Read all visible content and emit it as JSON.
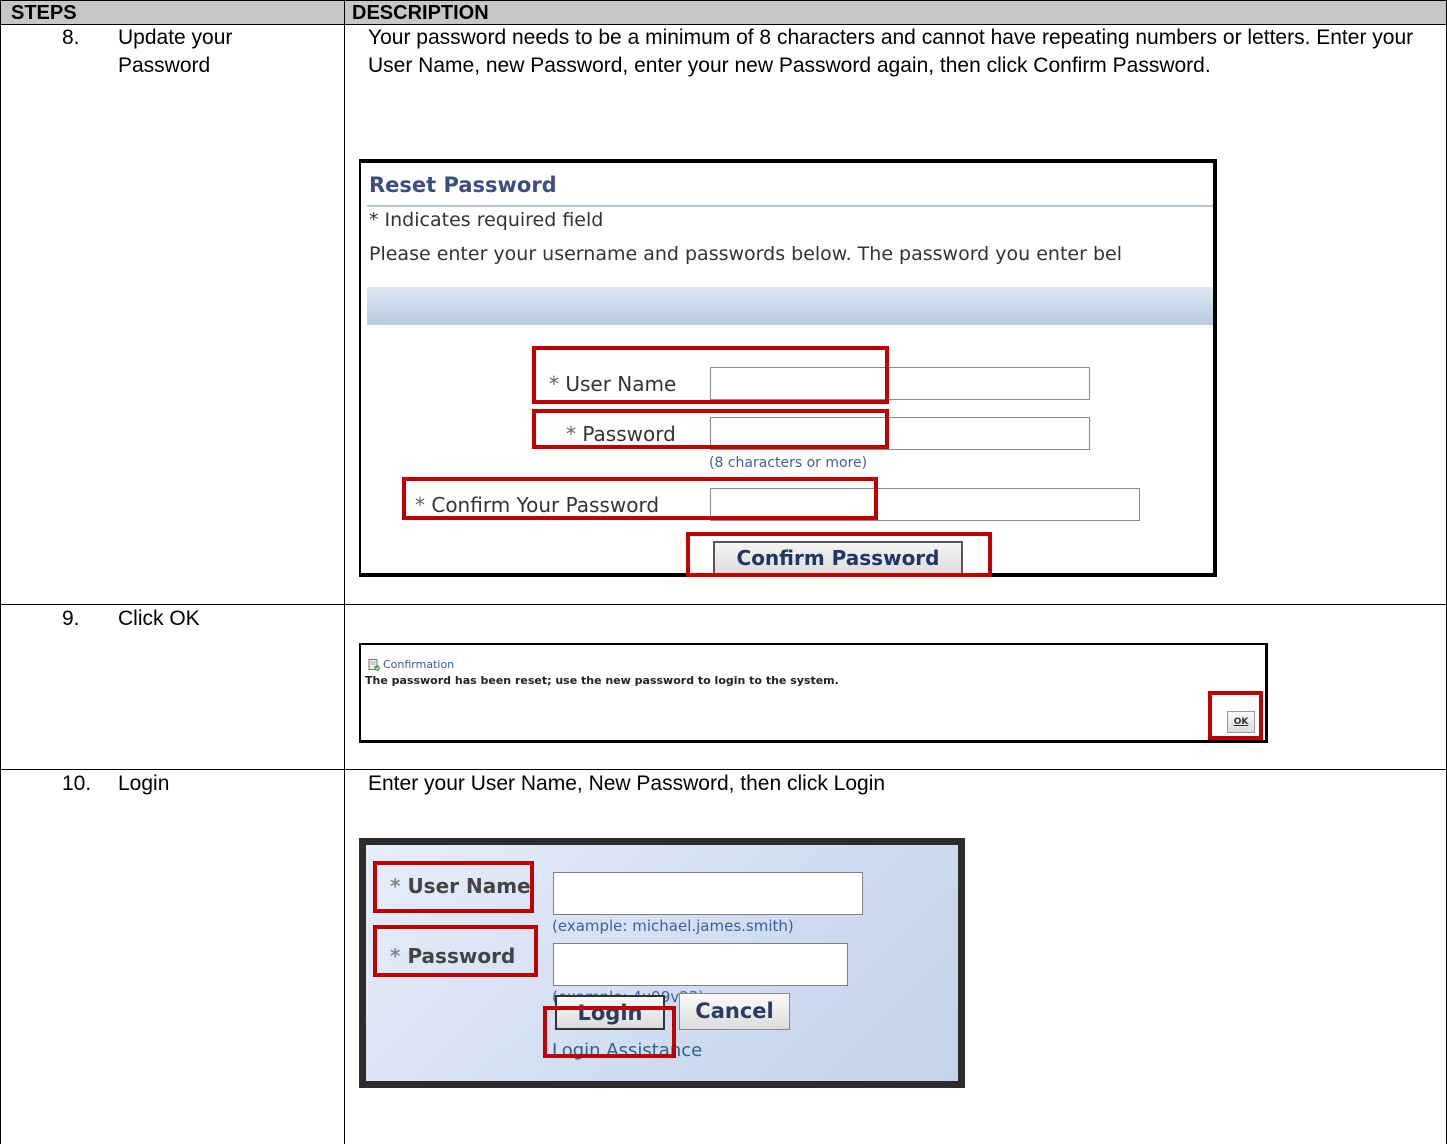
{
  "header": {
    "steps_label": "STEPS",
    "description_label": "DESCRIPTION"
  },
  "rows": [
    {
      "step_number": "8.",
      "step_title_line1": "Update your",
      "step_title_line2": "Password",
      "description": "Your password needs to be a minimum of 8 characters and cannot have repeating numbers or letters.  Enter your User Name, new Password, enter your new Password again, then click Confirm Password."
    },
    {
      "step_number": "9.",
      "step_title": "Click OK"
    },
    {
      "step_number": "10.",
      "step_title": "Login",
      "description": "Enter your User Name, New Password, then click Login"
    }
  ],
  "reset_password": {
    "title": "Reset Password",
    "required_note": "* Indicates required field",
    "instructions": "Please enter your username and passwords below. The password you enter bel",
    "user_name_label": "User Name",
    "password_label": "Password",
    "password_hint": "(8 characters or more)",
    "confirm_label": "Confirm Your Password",
    "required_mark": "*",
    "confirm_button": "Confirm Password"
  },
  "confirmation": {
    "title": "Confirmation",
    "message": "The password has been reset; use the new password to login to the system.",
    "ok_button": "OK"
  },
  "login": {
    "required_mark": "*",
    "user_name_label": "User Name",
    "user_name_hint": "(example: michael.james.smith)",
    "password_label": "Password",
    "password_hint": "(example: 4u99v23)",
    "login_button": "Login",
    "cancel_button": "Cancel",
    "assistance_link": "Login Assistance"
  },
  "colors": {
    "highlight": "#c00000",
    "header_bg": "#c6c6c6",
    "form_title": "#3a4e83",
    "link": "#2a6293"
  }
}
